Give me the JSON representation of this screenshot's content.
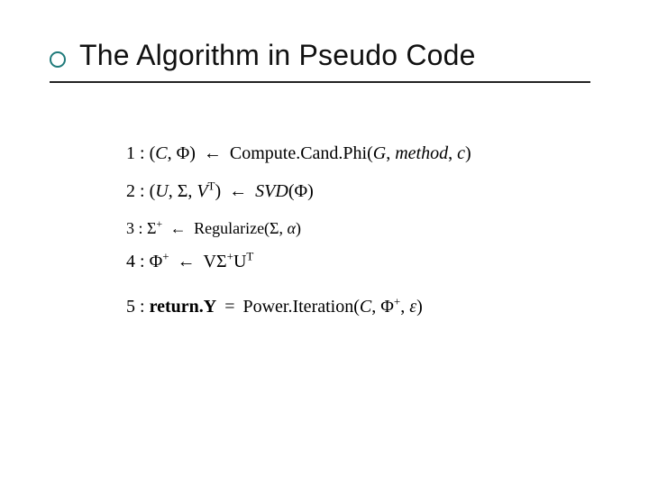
{
  "title": "The Algorithm in Pseudo Code",
  "line1": {
    "idx": "1 :",
    "lhs_open": "(",
    "C": "C",
    "comma1": ",",
    "Phi": "Φ",
    "lhs_close": ")",
    "arrow": "←",
    "fn": "Compute.Cand.Phi(",
    "G": "G",
    "comma2": ",",
    "method": "method",
    "comma3": ",",
    "c": "c",
    "fn_close": ")"
  },
  "line2": {
    "idx": "2 :",
    "lhs_open": "(",
    "U": "U",
    "comma1": ",",
    "Sigma": "Σ",
    "comma2": ",",
    "V": "V",
    "Tsup": "T",
    "lhs_close": ")",
    "arrow": "←",
    "fn": "SVD",
    "arg_open": "(",
    "Phi": "Φ",
    "arg_close": ")"
  },
  "line3": {
    "idx": "3 :",
    "Sigma": "Σ",
    "plus": "+",
    "arrow": "←",
    "fn": "Regularize(",
    "SigmaArg": "Σ",
    "comma": ",",
    "alpha": "α",
    "fn_close": ")"
  },
  "line4": {
    "idx": "4 :",
    "Phi": "Φ",
    "plus1": "+",
    "arrow": "←",
    "V": "V",
    "Sigma": "Σ",
    "plus2": "+",
    "U": "U",
    "Tsup": "T"
  },
  "line5": {
    "idx": "5 :",
    "ret": "return.Y",
    "eq": "=",
    "fn": "Power.Iteration(",
    "C": "C",
    "comma1": ",",
    "Phi": "Φ",
    "plus": "+",
    "comma2": ",",
    "eps": "ε",
    "fn_close": ")"
  }
}
